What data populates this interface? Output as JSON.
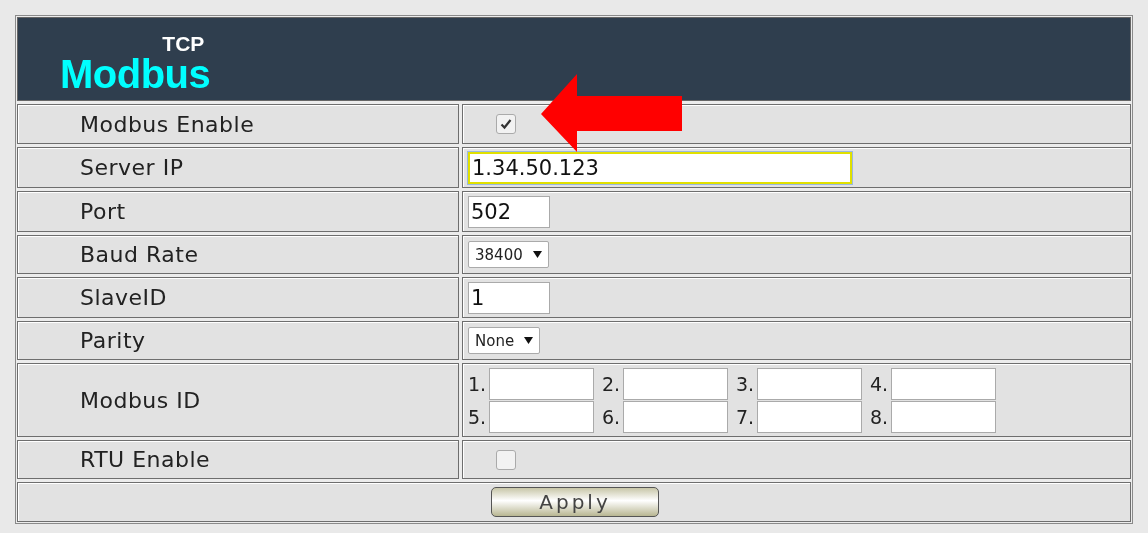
{
  "header": {
    "logo_small": "TCP",
    "logo_large": "Modbus"
  },
  "rows": [
    {
      "kind": "checkbox",
      "label": "Modbus Enable",
      "checked": true
    },
    {
      "kind": "text",
      "label": "Server IP",
      "value": "1.34.50.123",
      "focused": true,
      "wide": true
    },
    {
      "kind": "text",
      "label": "Port",
      "value": "502",
      "focused": false,
      "wide": false
    },
    {
      "kind": "select",
      "label": "Baud Rate",
      "value": "38400"
    },
    {
      "kind": "text",
      "label": "SlaveID",
      "value": "1",
      "focused": false,
      "wide": false
    },
    {
      "kind": "select",
      "label": "Parity",
      "value": "None"
    },
    {
      "kind": "id-grid",
      "label": "Modbus ID",
      "slots": [
        "1.",
        "2.",
        "3.",
        "4.",
        "5.",
        "6.",
        "7.",
        "8."
      ]
    },
    {
      "kind": "checkbox",
      "label": "RTU Enable",
      "checked": false
    }
  ],
  "apply_button": "Apply"
}
